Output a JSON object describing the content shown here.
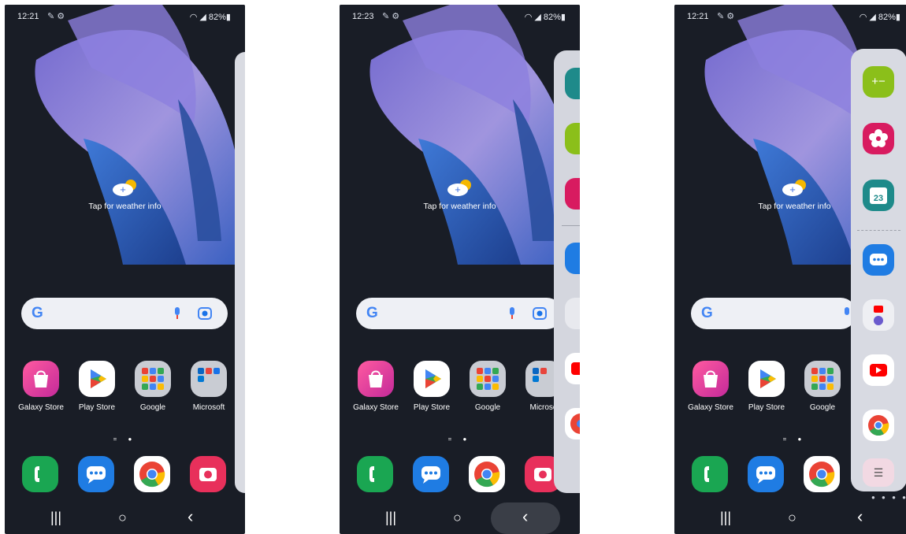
{
  "screens": [
    {
      "status": {
        "time": "12:21",
        "notif": "✎ ⚙",
        "right": "◠ ◢ 82%▮"
      },
      "weather": {
        "label": "Tap for weather info"
      },
      "apps": [
        {
          "label": "Galaxy Store"
        },
        {
          "label": "Play Store"
        },
        {
          "label": "Google"
        },
        {
          "label": "Microsoft"
        }
      ]
    },
    {
      "status": {
        "time": "12:23",
        "notif": "✎ ⚙",
        "right": "◠ ◢ 82%▮"
      },
      "weather": {
        "label": "Tap for weather info"
      },
      "apps": [
        {
          "label": "Galaxy Store"
        },
        {
          "label": "Play Store"
        },
        {
          "label": "Google"
        },
        {
          "label": "Microso"
        }
      ]
    },
    {
      "status": {
        "time": "12:21",
        "notif": "✎ ⚙",
        "right": "◠ ◢ 82%▮"
      },
      "weather": {
        "label": "Tap for weather info"
      },
      "apps": [
        {
          "label": "Galaxy Store"
        },
        {
          "label": "Play Store"
        },
        {
          "label": "Google"
        }
      ]
    }
  ],
  "edge_panel": {
    "calendar_day": "23",
    "menu_glyph": "☰"
  },
  "nav": {
    "recents": "|||",
    "home": "○",
    "back": "‹"
  },
  "colors": {
    "background": "#191d26",
    "galaxy_store": "#e3317a",
    "phone_green": "#1aa652",
    "messages_blue": "#1f7ce3",
    "camera_red": "#e8305b",
    "calculator_green": "#8bbf1a",
    "bixby_pink": "#d81b60",
    "calendar_teal": "#1e8a8a"
  }
}
